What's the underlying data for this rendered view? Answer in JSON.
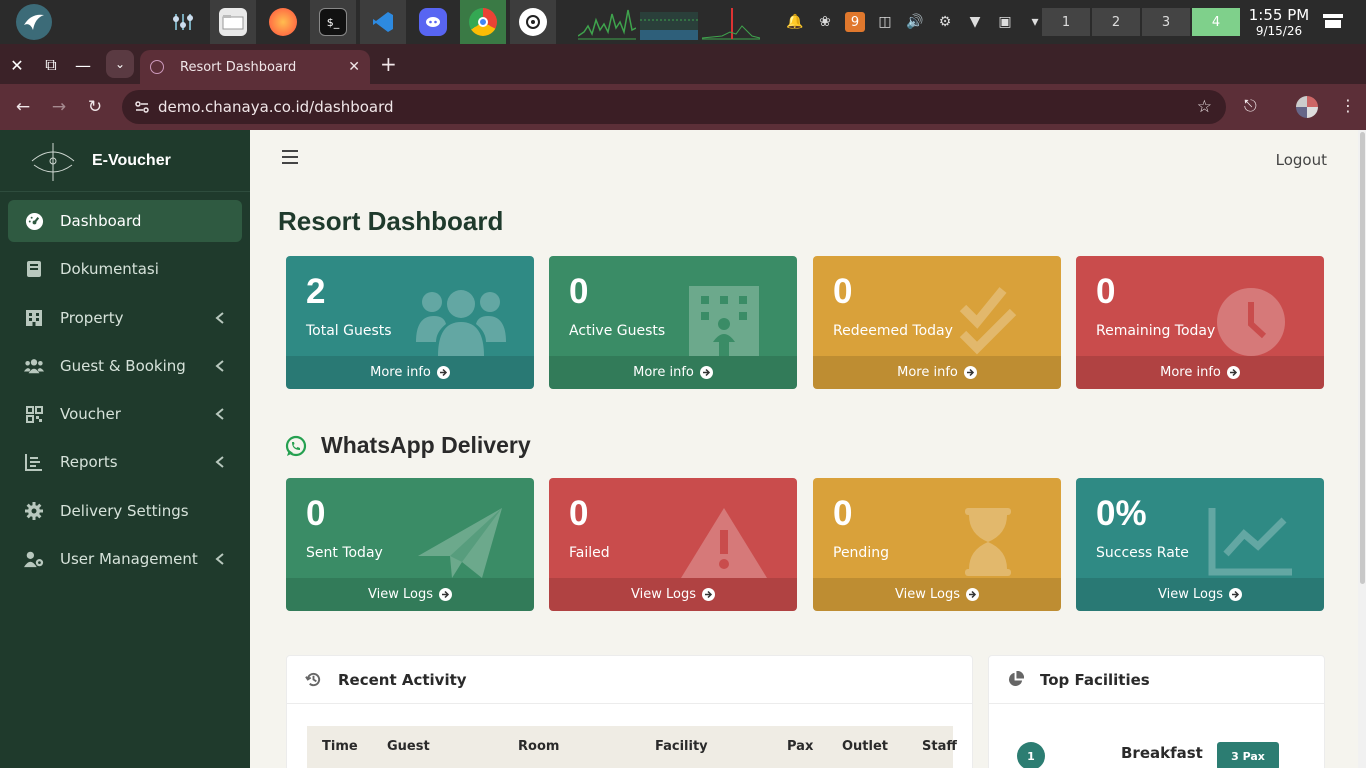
{
  "taskbar": {
    "clock_time": "1:55 PM",
    "clock_date": "9/15/26",
    "tray_badge": "9",
    "workspaces": [
      "1",
      "2",
      "3",
      "4"
    ],
    "active_workspace_color": "#7fd08b"
  },
  "browser": {
    "tab_title": "Resort Dashboard",
    "url": "demo.chanaya.co.id/dashboard",
    "chrome_color": "#5c2f38"
  },
  "sidebar": {
    "brand": "E-Voucher",
    "items": [
      {
        "label": "Dashboard",
        "icon": "gauge-icon",
        "active": true,
        "chevron": false
      },
      {
        "label": "Dokumentasi",
        "icon": "book-icon",
        "active": false,
        "chevron": false
      },
      {
        "label": "Property",
        "icon": "building-icon",
        "active": false,
        "chevron": true
      },
      {
        "label": "Guest & Booking",
        "icon": "users-icon",
        "active": false,
        "chevron": true
      },
      {
        "label": "Voucher",
        "icon": "qrcode-icon",
        "active": false,
        "chevron": true
      },
      {
        "label": "Reports",
        "icon": "chart-icon",
        "active": false,
        "chevron": true
      },
      {
        "label": "Delivery Settings",
        "icon": "gear-icon",
        "active": false,
        "chevron": false
      },
      {
        "label": "User Management",
        "icon": "user-gear-icon",
        "active": false,
        "chevron": true
      }
    ]
  },
  "header": {
    "logout": "Logout"
  },
  "page": {
    "title": "Resort Dashboard"
  },
  "stats": [
    {
      "value": "2",
      "label": "Total Guests",
      "link": "More info",
      "color": "#2f8a84",
      "icon": "users-icon"
    },
    {
      "value": "0",
      "label": "Active Guests",
      "link": "More info",
      "color": "#3a8c66",
      "icon": "hotel-icon"
    },
    {
      "value": "0",
      "label": "Redeemed Today",
      "link": "More info",
      "color": "#d9a13a",
      "icon": "double-check-icon"
    },
    {
      "value": "0",
      "label": "Remaining Today",
      "link": "More info",
      "color": "#c94c4c",
      "icon": "clock-icon"
    }
  ],
  "whatsapp": {
    "title": "WhatsApp Delivery",
    "cards": [
      {
        "value": "0",
        "label": "Sent Today",
        "link": "View Logs",
        "color": "#3a8c66",
        "icon": "paper-plane-icon"
      },
      {
        "value": "0",
        "label": "Failed",
        "link": "View Logs",
        "color": "#c94c4c",
        "icon": "warning-icon"
      },
      {
        "value": "0",
        "label": "Pending",
        "link": "View Logs",
        "color": "#d9a13a",
        "icon": "hourglass-icon"
      },
      {
        "value": "0%",
        "label": "Success Rate",
        "link": "View Logs",
        "color": "#2f8a84",
        "icon": "line-chart-icon"
      }
    ]
  },
  "recent_activity": {
    "title": "Recent Activity",
    "columns": [
      "Time",
      "Guest",
      "Room",
      "Facility",
      "Pax",
      "Outlet",
      "Staff"
    ]
  },
  "top_facilities": {
    "title": "Top Facilities",
    "items": [
      {
        "rank": "1",
        "name": "Breakfast",
        "pax": "3 Pax"
      }
    ]
  }
}
